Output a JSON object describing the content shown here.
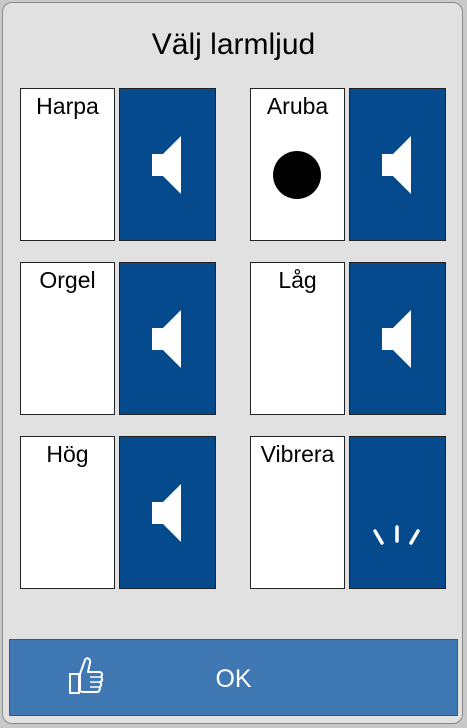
{
  "dialog": {
    "title": "Välj larmljud",
    "options": [
      {
        "label": "Harpa",
        "selected": false,
        "play_icon": "speaker-icon"
      },
      {
        "label": "Aruba",
        "selected": true,
        "play_icon": "speaker-icon"
      },
      {
        "label": "Orgel",
        "selected": false,
        "play_icon": "speaker-icon"
      },
      {
        "label": "Låg",
        "selected": false,
        "play_icon": "speaker-icon"
      },
      {
        "label": "Hög",
        "selected": false,
        "play_icon": "speaker-icon"
      },
      {
        "label": "Vibrera",
        "selected": false,
        "play_icon": "vibrate-icon"
      }
    ],
    "ok_label": "OK",
    "ok_icon": "thumbs-up-icon"
  },
  "colors": {
    "background": "#e1e1e1",
    "play_button": "#044a8c",
    "ok_bar": "#3f78b2",
    "card": "#ffffff"
  }
}
